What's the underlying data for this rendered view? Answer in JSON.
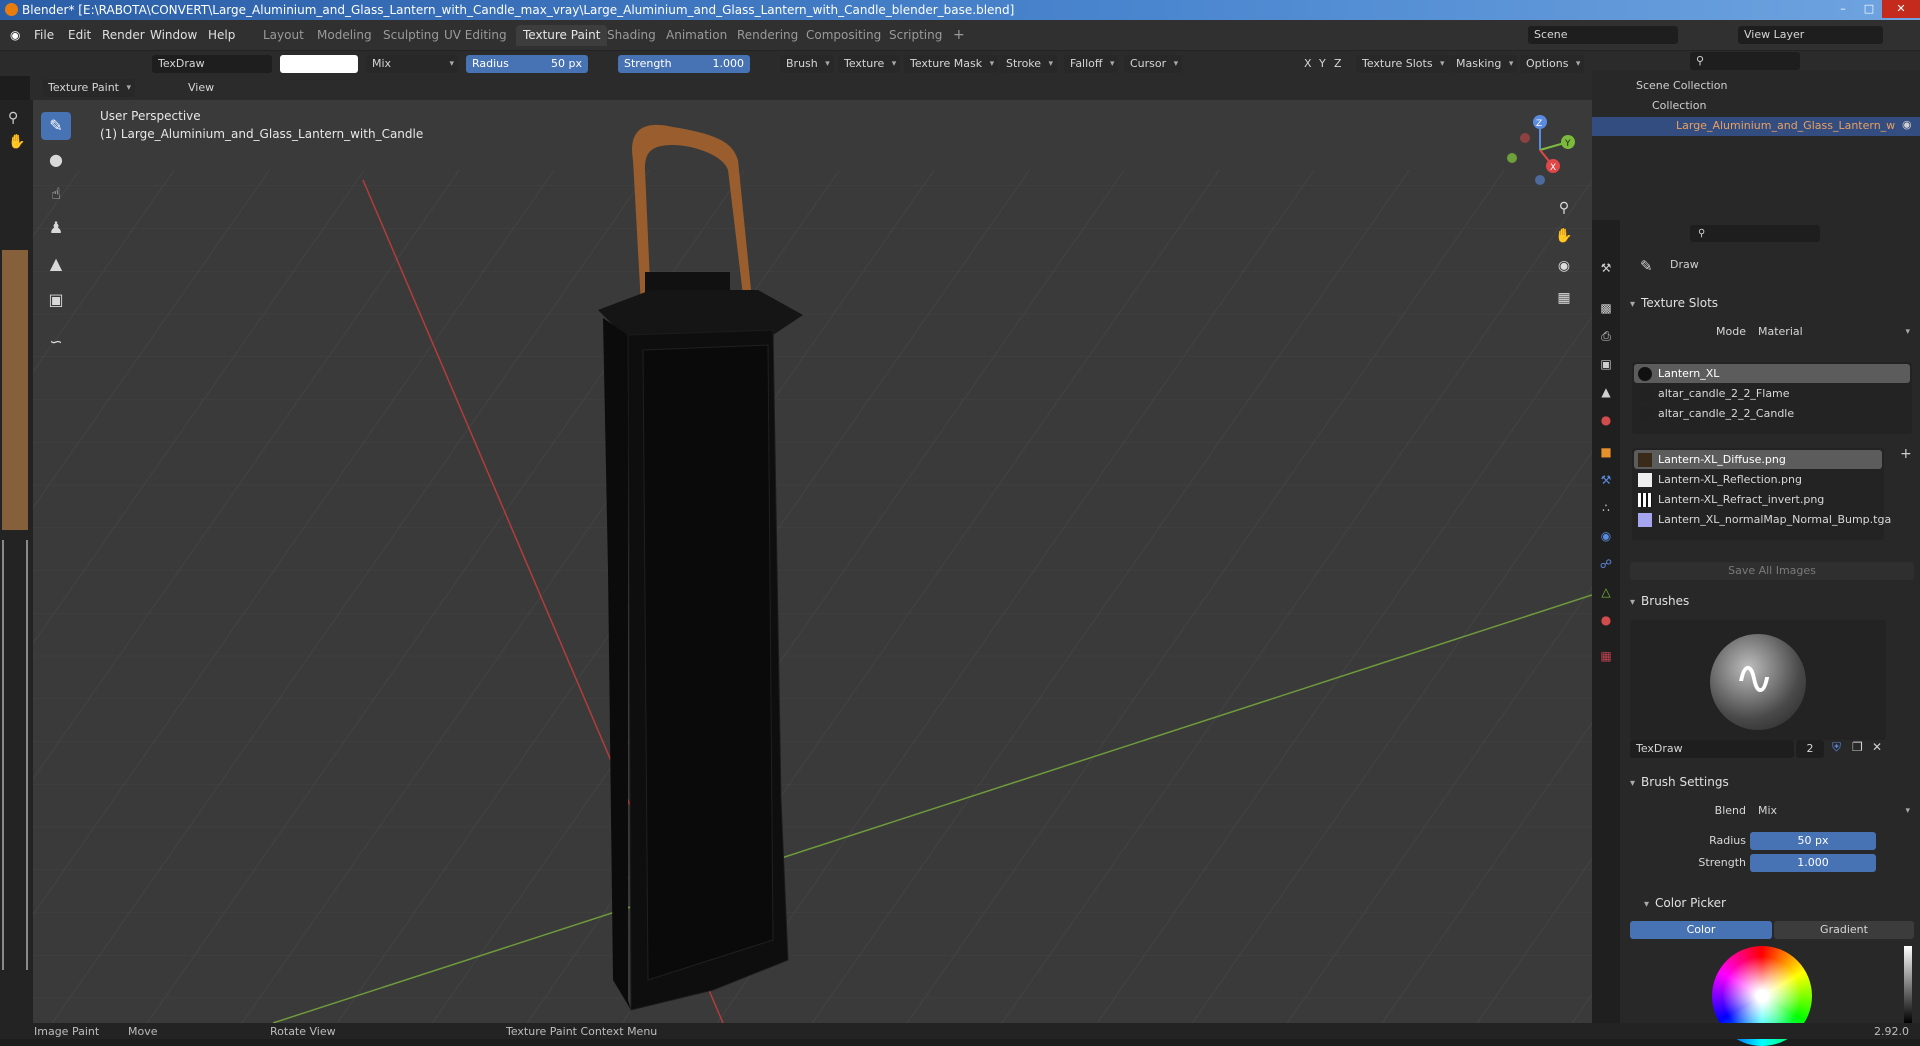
{
  "window": {
    "title": "Blender* [E:\\RABOTA\\CONVERT\\Large_Aluminium_and_Glass_Lantern_with_Candle_max_vray\\Large_Aluminium_and_Glass_Lantern_with_Candle_blender_base.blend]"
  },
  "menu": [
    "File",
    "Edit",
    "Render",
    "Window",
    "Help"
  ],
  "workspaces": [
    "Layout",
    "Modeling",
    "Sculpting",
    "UV Editing",
    "Texture Paint",
    "Shading",
    "Animation",
    "Rendering",
    "Compositing",
    "Scripting"
  ],
  "active_workspace": "Texture Paint",
  "scene": {
    "label": "Scene",
    "view_layer": "View Layer"
  },
  "toolbar": {
    "brush_name": "TexDraw",
    "blend": "Mix",
    "radius_label": "Radius",
    "radius_value": "50 px",
    "strength_label": "Strength",
    "strength_value": "1.000",
    "menus": [
      "Brush",
      "Texture",
      "Texture Mask",
      "Stroke",
      "Falloff",
      "Cursor"
    ],
    "axes": [
      "X",
      "Y",
      "Z"
    ],
    "texture_slots": "Texture Slots",
    "masking": "Masking",
    "options": "Options"
  },
  "header": {
    "mode": "Texture Paint",
    "view": "View"
  },
  "viewport": {
    "perspective": "User Perspective",
    "object": "(1) Large_Aluminium_and_Glass_Lantern_with_Candle",
    "gizmo": {
      "x": "X",
      "y": "Y",
      "z": "Z"
    }
  },
  "outliner": {
    "scene_collection": "Scene Collection",
    "collection": "Collection",
    "object": "Large_Aluminium_and_Glass_Lantern_w"
  },
  "properties": {
    "tool_name": "Draw",
    "texture_slots": {
      "title": "Texture Slots",
      "mode_label": "Mode",
      "mode_value": "Material",
      "materials": [
        "Lantern_XL",
        "altar_candle_2_2_Flame",
        "altar_candle_2_2_Candle"
      ],
      "images": [
        "Lantern-XL_Diffuse.png",
        "Lantern-XL_Reflection.png",
        "Lantern-XL_Refract_invert.png",
        "Lantern_XL_normalMap_Normal_Bump.tga"
      ],
      "save_all": "Save All Images"
    },
    "brushes": {
      "title": "Brushes",
      "name": "TexDraw",
      "users": "2"
    },
    "brush_settings": {
      "title": "Brush Settings",
      "blend_label": "Blend",
      "blend_value": "Mix",
      "radius_label": "Radius",
      "radius_value": "50 px",
      "strength_label": "Strength",
      "strength_value": "1.000"
    },
    "color_picker": {
      "title": "Color Picker",
      "tabs": [
        "Color",
        "Gradient"
      ]
    }
  },
  "statusbar": {
    "image_paint": "Image Paint",
    "move": "Move",
    "rotate": "Rotate View",
    "context": "Texture Paint Context Menu",
    "version": "2.92.0"
  },
  "colors": {
    "accent": "#4772b3",
    "viewport_bg": "#3a3a3a"
  }
}
